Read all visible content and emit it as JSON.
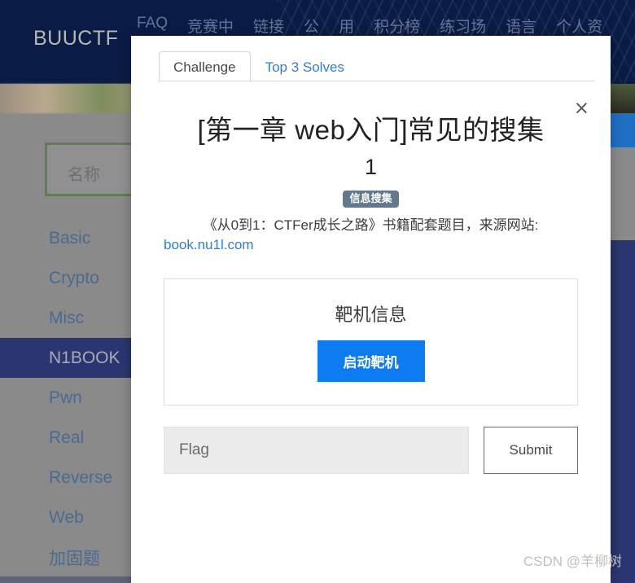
{
  "site": {
    "brand": "BUUCTF",
    "nav_items": [
      "FAQ",
      "竞赛中",
      "链接",
      "公",
      "用",
      "积分榜",
      "练习场",
      "语言",
      "个人资"
    ]
  },
  "sidebar": {
    "search_placeholder": "名称",
    "items": [
      {
        "label": "Basic",
        "active": false
      },
      {
        "label": "Crypto",
        "active": false
      },
      {
        "label": "Misc",
        "active": false
      },
      {
        "label": "N1BOOK",
        "active": true
      },
      {
        "label": "Pwn",
        "active": false
      },
      {
        "label": "Real",
        "active": false
      },
      {
        "label": "Reverse",
        "active": false
      },
      {
        "label": "Web",
        "active": false
      },
      {
        "label": "加固题",
        "active": false
      }
    ]
  },
  "modal": {
    "tabs": [
      {
        "label": "Challenge",
        "active": true
      },
      {
        "label": "Top 3 Solves",
        "active": false
      }
    ],
    "close_label": "×",
    "challenge": {
      "title": "[第一章 web入门]常见的搜集",
      "points": "1",
      "tag": "信息搜集",
      "description": "《从0到1：CTFer成长之路》书籍配套题目，来源网站:",
      "link": "book.nu1l.com"
    },
    "target": {
      "title": "靶机信息",
      "button_label": "启动靶机"
    },
    "flag": {
      "placeholder": "Flag",
      "value": "",
      "submit_label": "Submit"
    }
  },
  "watermark": "CSDN @羊柳树",
  "colors": {
    "header_bg": "#0a1b45",
    "sidebar_active": "#2b3570",
    "link_blue": "#2b7fd4",
    "primary_button": "#0d7cf2",
    "tag_bg": "#62788f",
    "search_border": "#5f7e52"
  }
}
